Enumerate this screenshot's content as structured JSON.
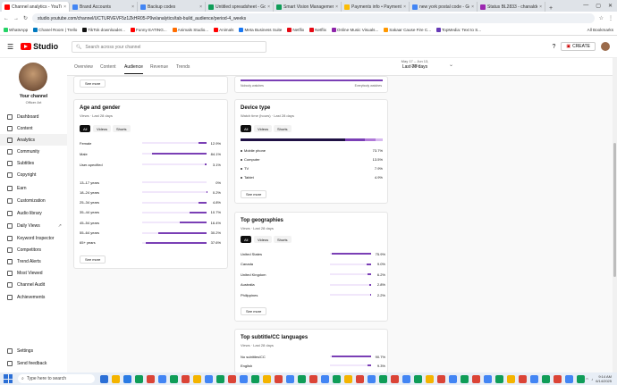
{
  "browser": {
    "tabs": [
      {
        "title": "Channel analytics - YouTu",
        "color": "#ff0000",
        "active": true
      },
      {
        "title": "Brand Accounts",
        "color": "#4285f4"
      },
      {
        "title": "Backup codes",
        "color": "#4285f4"
      },
      {
        "title": "Untitled spreadsheet - Go",
        "color": "#0f9d58"
      },
      {
        "title": "Smart Vision Management",
        "color": "#0f9d58"
      },
      {
        "title": "Payments info • Payment",
        "color": "#fbbc04"
      },
      {
        "title": "new york postal code - Go",
        "color": "#4285f4"
      },
      {
        "title": "Status BL2833 - chanaldev",
        "color": "#9c27b0"
      }
    ],
    "url": "studio.youtube.com/channel/UCTURVEVF5z1ZkHR05-P9w/analytics/tab-build_audience/period-4_weeks",
    "bookmarks": [
      {
        "label": "WhatsApp",
        "color": "#25d366"
      },
      {
        "label": "Chanel Room | Trello",
        "color": "#0079bf"
      },
      {
        "label": "TikTok downloader...",
        "color": "#111111"
      },
      {
        "label": "Funny EATING...",
        "color": "#ff0000"
      },
      {
        "label": "Animals Studio...",
        "color": "#ff6d00"
      },
      {
        "label": "Animals",
        "color": "#ff0000"
      },
      {
        "label": "Meta Business Suite",
        "color": "#1877f2"
      },
      {
        "label": "Netflix",
        "color": "#e50914"
      },
      {
        "label": "Netflix",
        "color": "#e50914"
      },
      {
        "label": "Online Music Visuals...",
        "color": "#8e24aa"
      },
      {
        "label": "Sakaar Cause Fire C...",
        "color": "#ff9800"
      },
      {
        "label": "TopMedia: Text to S...",
        "color": "#673ab7"
      }
    ],
    "all_bookmarks": "All Bookmarks"
  },
  "studio": {
    "logo_text": "Studio",
    "search_placeholder": "Search across your channel",
    "create_label": "CREATE"
  },
  "channel": {
    "name": "Your channel",
    "subtitle": "Officer Art"
  },
  "sidebar": [
    {
      "label": "Dashboard"
    },
    {
      "label": "Content"
    },
    {
      "label": "Analytics",
      "active": true
    },
    {
      "label": "Community"
    },
    {
      "label": "Subtitles"
    },
    {
      "label": "Copyright"
    },
    {
      "label": "Earn"
    },
    {
      "label": "Customization"
    },
    {
      "label": "Audio library"
    },
    {
      "label": "Daily Views",
      "external": true
    },
    {
      "label": "Keyword Inspector"
    },
    {
      "label": "Competitors"
    },
    {
      "label": "Trend Alerts"
    },
    {
      "label": "Most Viewed"
    },
    {
      "label": "Channel Audit"
    },
    {
      "label": "Achievements"
    }
  ],
  "sidebar_bottom": [
    {
      "label": "Settings"
    },
    {
      "label": "Send feedback"
    }
  ],
  "analytics_tabs": [
    "Overview",
    "Content",
    "Audience",
    "Revenue",
    "Trends"
  ],
  "date": {
    "range": "May 17 – Jun 13, 2025",
    "label": "Last 28 days"
  },
  "left_top_card": {
    "see_more": "See more"
  },
  "right_top_card": {
    "left_caption": "Nobody watches",
    "right_caption": "Everybody watches"
  },
  "age_gender": {
    "title": "Age and gender",
    "subtitle": "Views · Last 28 days",
    "filters": [
      "All",
      "Videos",
      "Shorts"
    ],
    "gender": [
      {
        "label": "Female",
        "value": "12.9%",
        "pct": 12.9
      },
      {
        "label": "Male",
        "value": "84.1%",
        "pct": 84.1
      },
      {
        "label": "User-specified",
        "value": "3.1%",
        "pct": 3.1
      }
    ],
    "ages": [
      {
        "label": "13–17 years",
        "value": "0%",
        "pct": 0
      },
      {
        "label": "18–24 years",
        "value": "0.2%",
        "pct": 0.2
      },
      {
        "label": "25–34 years",
        "value": "4.8%",
        "pct": 4.8
      },
      {
        "label": "35–44 years",
        "value": "10.7%",
        "pct": 10.7
      },
      {
        "label": "45–54 years",
        "value": "16.4%",
        "pct": 16.4
      },
      {
        "label": "55–64 years",
        "value": "30.2%",
        "pct": 30.2
      },
      {
        "label": "65+ years",
        "value": "37.6%",
        "pct": 37.6
      }
    ],
    "see_more": "See more"
  },
  "device": {
    "title": "Device type",
    "subtitle": "Watch time (hours) · Last 28 days",
    "filters": [
      "All",
      "Videos",
      "Shorts"
    ],
    "items": [
      {
        "label": "Mobile phone",
        "value": "73.7%",
        "pct": 73.7,
        "color": "#1f1144"
      },
      {
        "label": "Computer",
        "value": "13.5%",
        "pct": 13.5,
        "color": "#7a3fb5"
      },
      {
        "label": "TV",
        "value": "7.9%",
        "pct": 7.9,
        "color": "#b07ad8"
      },
      {
        "label": "Tablet",
        "value": "4.9%",
        "pct": 4.9,
        "color": "#d7b9ef"
      }
    ],
    "see_more": "See more"
  },
  "geo": {
    "title": "Top geographies",
    "subtitle": "Views · Last 28 days",
    "filters": [
      "All",
      "Videos",
      "Shorts"
    ],
    "items": [
      {
        "label": "United States",
        "value": "75.9%",
        "pct": 75.9
      },
      {
        "label": "Canada",
        "value": "9.0%",
        "pct": 9.0
      },
      {
        "label": "United Kingdom",
        "value": "6.2%",
        "pct": 6.2
      },
      {
        "label": "Australia",
        "value": "2.8%",
        "pct": 2.8
      },
      {
        "label": "Philippines",
        "value": "2.2%",
        "pct": 2.2
      }
    ],
    "see_more": "See more"
  },
  "subtitles": {
    "title": "Top subtitle/CC languages",
    "subtitle": "Views · Last 28 days",
    "items": [
      {
        "label": "No subtitles/CC",
        "value": "90.7%",
        "pct": 90.7
      },
      {
        "label": "English",
        "value": "9.3%",
        "pct": 9.3
      }
    ]
  },
  "taskbar": {
    "search": "Type here to search",
    "time": "9:14 AM",
    "date": "6/14/2025",
    "icon_colors": [
      "#2b6fd6",
      "#f4b400",
      "#2a7be4",
      "#0f9d58",
      "#db4437",
      "#4285f4",
      "#0f9d58",
      "#db4437",
      "#f4b400",
      "#4285f4",
      "#0f9d58",
      "#db4437",
      "#4285f4",
      "#0f9d58",
      "#f4b400",
      "#db4437",
      "#4285f4",
      "#0f9d58",
      "#db4437",
      "#4285f4",
      "#0f9d58",
      "#f4b400",
      "#db4437",
      "#4285f4",
      "#0f9d58",
      "#db4437",
      "#4285f4",
      "#0f9d58",
      "#f4b400",
      "#db4437",
      "#4285f4",
      "#0f9d58",
      "#db4437",
      "#4285f4",
      "#0f9d58",
      "#f4b400",
      "#db4437",
      "#4285f4",
      "#0f9d58",
      "#db4437",
      "#4285f4",
      "#0f9d58"
    ]
  }
}
